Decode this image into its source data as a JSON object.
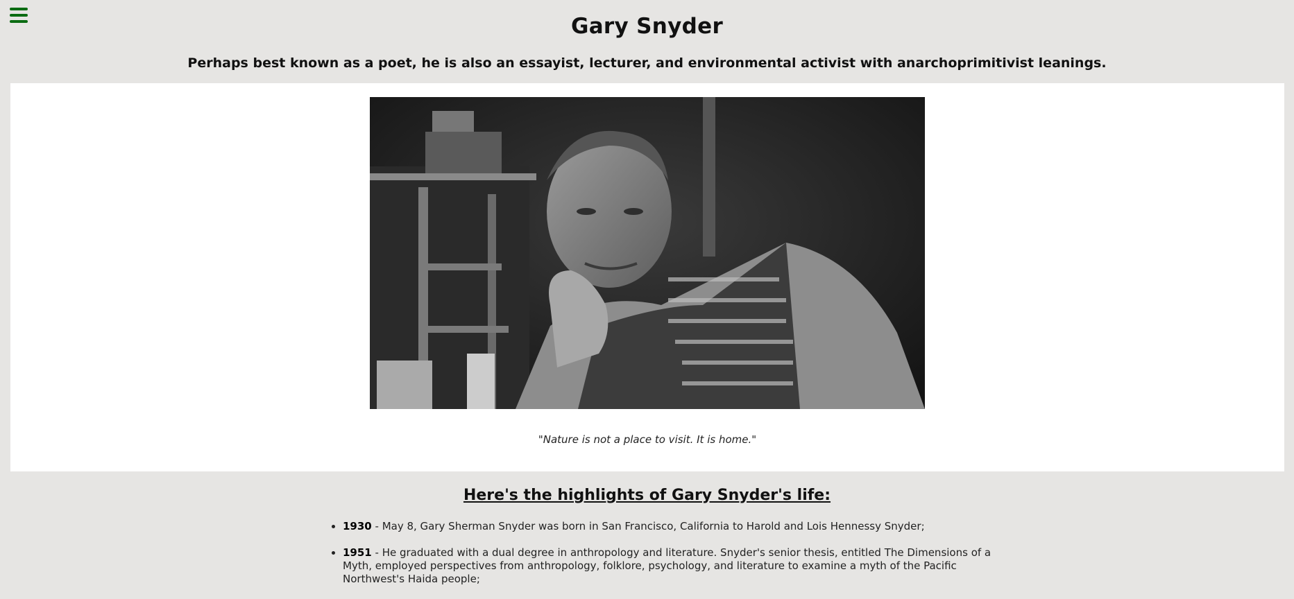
{
  "header": {
    "title": "Gary Snyder",
    "subtitle": "Perhaps best known as a poet, he is also an essayist, lecturer, and environmental activist with anarchoprimitivist leanings."
  },
  "menu": {
    "icon": "hamburger-menu-icon",
    "color": "#0b6b12"
  },
  "image_panel": {
    "caption": "\"Nature is not a place to visit. It is home.\""
  },
  "highlights": {
    "title": "Here's the highlights of Gary Snyder's life:",
    "items": [
      {
        "year": "1930",
        "text": " - May 8, Gary Sherman Snyder was born in San Francisco, California to Harold and Lois Hennessy Snyder;"
      },
      {
        "year": "1951",
        "text": " - He graduated with a dual degree in anthropology and literature. Snyder's senior thesis, entitled The Dimensions of a Myth, employed perspectives from anthropology, folklore, psychology, and literature to examine a myth of the Pacific Northwest's Haida people;"
      }
    ]
  }
}
